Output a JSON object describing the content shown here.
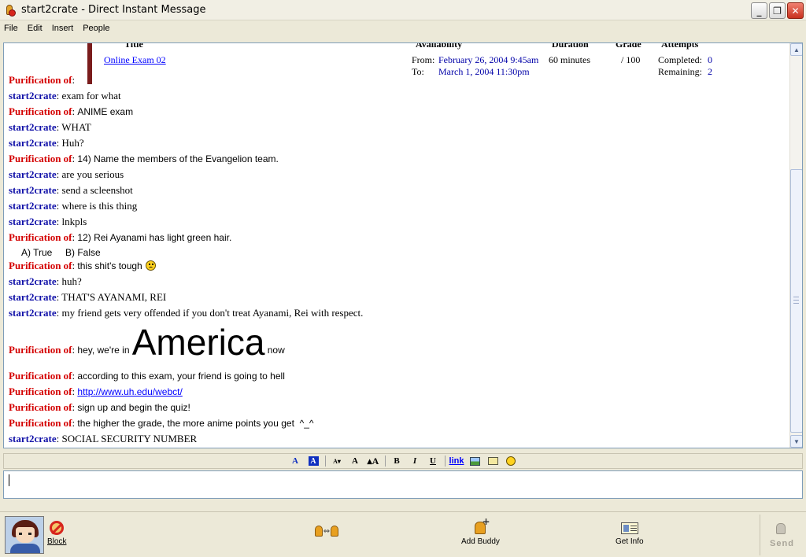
{
  "window": {
    "title": "start2crate - Direct Instant Message",
    "minimize": "_",
    "maximize": "❐",
    "close": "✕"
  },
  "menu": [
    "File",
    "Edit",
    "Insert",
    "People"
  ],
  "exam": {
    "headers": [
      "Title",
      "Availability",
      "Duration",
      "Grade",
      "Attempts"
    ],
    "link": "Online Exam 02",
    "from_label": "From:",
    "from_value": "February 26, 2004 9:45am",
    "to_label": "To:",
    "to_value": "March 1, 2004 11:30pm",
    "duration": "60 minutes",
    "grade": "/ 100",
    "completed_label": "Completed:",
    "completed_value": "0",
    "remaining_label": "Remaining:",
    "remaining_value": "2"
  },
  "screennames": {
    "them": "Purification of",
    "me": "start2crate"
  },
  "messages": [
    {
      "from": "them",
      "text": ""
    },
    {
      "from": "me",
      "text": "exam for what"
    },
    {
      "from": "them",
      "text": "ANIME exam"
    },
    {
      "from": "me",
      "text": "WHAT"
    },
    {
      "from": "me",
      "text": "Huh?"
    },
    {
      "from": "them",
      "text": "14) Name the members of the Evangelion team."
    },
    {
      "from": "me",
      "text": "are you serious"
    },
    {
      "from": "me",
      "text": "send a scleenshot"
    },
    {
      "from": "me",
      "text": "where is this thing"
    },
    {
      "from": "me",
      "text": "lnkpls"
    },
    {
      "from": "them",
      "text": "12) Rei Ayanami has light green hair."
    },
    {
      "from": "none",
      "text": "A) True     B) False"
    },
    {
      "from": "them",
      "text": "this shit's tough"
    },
    {
      "from": "me",
      "text": "huh?"
    },
    {
      "from": "me",
      "text": "THAT'S AYANAMI, REI"
    },
    {
      "from": "me",
      "text": "my friend gets very offended if you don't treat Ayanami, Rei with respect."
    },
    {
      "from": "them",
      "text_before": "hey, we're in",
      "big_text": "America",
      "text_after": "now"
    },
    {
      "from": "them",
      "text": "according to this exam, your friend is going to hell"
    },
    {
      "from": "them",
      "text": "http://www.uh.edu/webct/"
    },
    {
      "from": "them",
      "text": "sign up and begin the quiz!"
    },
    {
      "from": "them",
      "text": "the higher the grade, the more anime points you get  ^_^"
    },
    {
      "from": "me",
      "text": "SOCIAL SECURITY NUMBER"
    }
  ],
  "format_toolbar": {
    "link": "link"
  },
  "bottom": {
    "block": "Block",
    "add_buddy": "Add Buddy",
    "get_info": "Get Info",
    "send": "Send"
  }
}
